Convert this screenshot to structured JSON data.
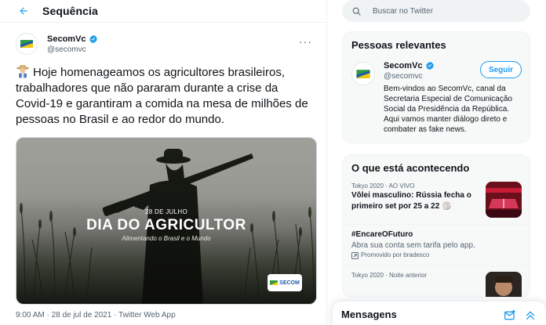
{
  "header": {
    "title": "Sequência"
  },
  "tweet": {
    "author_name": "SecomVc",
    "author_handle": "@secomvc",
    "text": "Hoje homenageamos os agricultores brasileiros, trabalhadores que não pararam durante a crise da Covid-19 e garantiram a comida na mesa de milhões de pessoas no Brasil e ao redor do mundo.",
    "media": {
      "date": "28 DE JULHO",
      "title": "DIA DO AGRICULTOR",
      "subtitle": "Alimentando o Brasil e o Mundo",
      "badge": "SECOM"
    },
    "meta": "9:00 AM · 28 de jul de 2021 · Twitter Web App"
  },
  "search": {
    "placeholder": "Buscar no Twitter"
  },
  "relevant": {
    "title": "Pessoas relevantes",
    "person": {
      "name": "SecomVc",
      "handle": "@secomvc",
      "follow_label": "Seguir",
      "bio": "Bem-vindos ao SecomVc, canal da Secretaria Especial de Comunicação Social da Presidência da República. Aqui vamos manter diálogo direto e combater as fake news."
    }
  },
  "trends": {
    "title": "O que está acontecendo",
    "items": [
      {
        "context": "Tokyo 2020 · AO VIVO",
        "title": "Vôlei masculino: Rússia fecha o primeiro set por 25 a 22 🏐"
      },
      {
        "title": "#EncareOFuturo",
        "description": "Abra sua conta sem tarifa pelo app.",
        "promo": "Promovido por bradesco"
      },
      {
        "context": "Tokyo 2020 · Noite anterior"
      }
    ]
  },
  "messages": {
    "title": "Mensagens"
  },
  "colors": {
    "accent": "#1d9bf0",
    "text": "#0f1419",
    "secondary": "#536471"
  }
}
